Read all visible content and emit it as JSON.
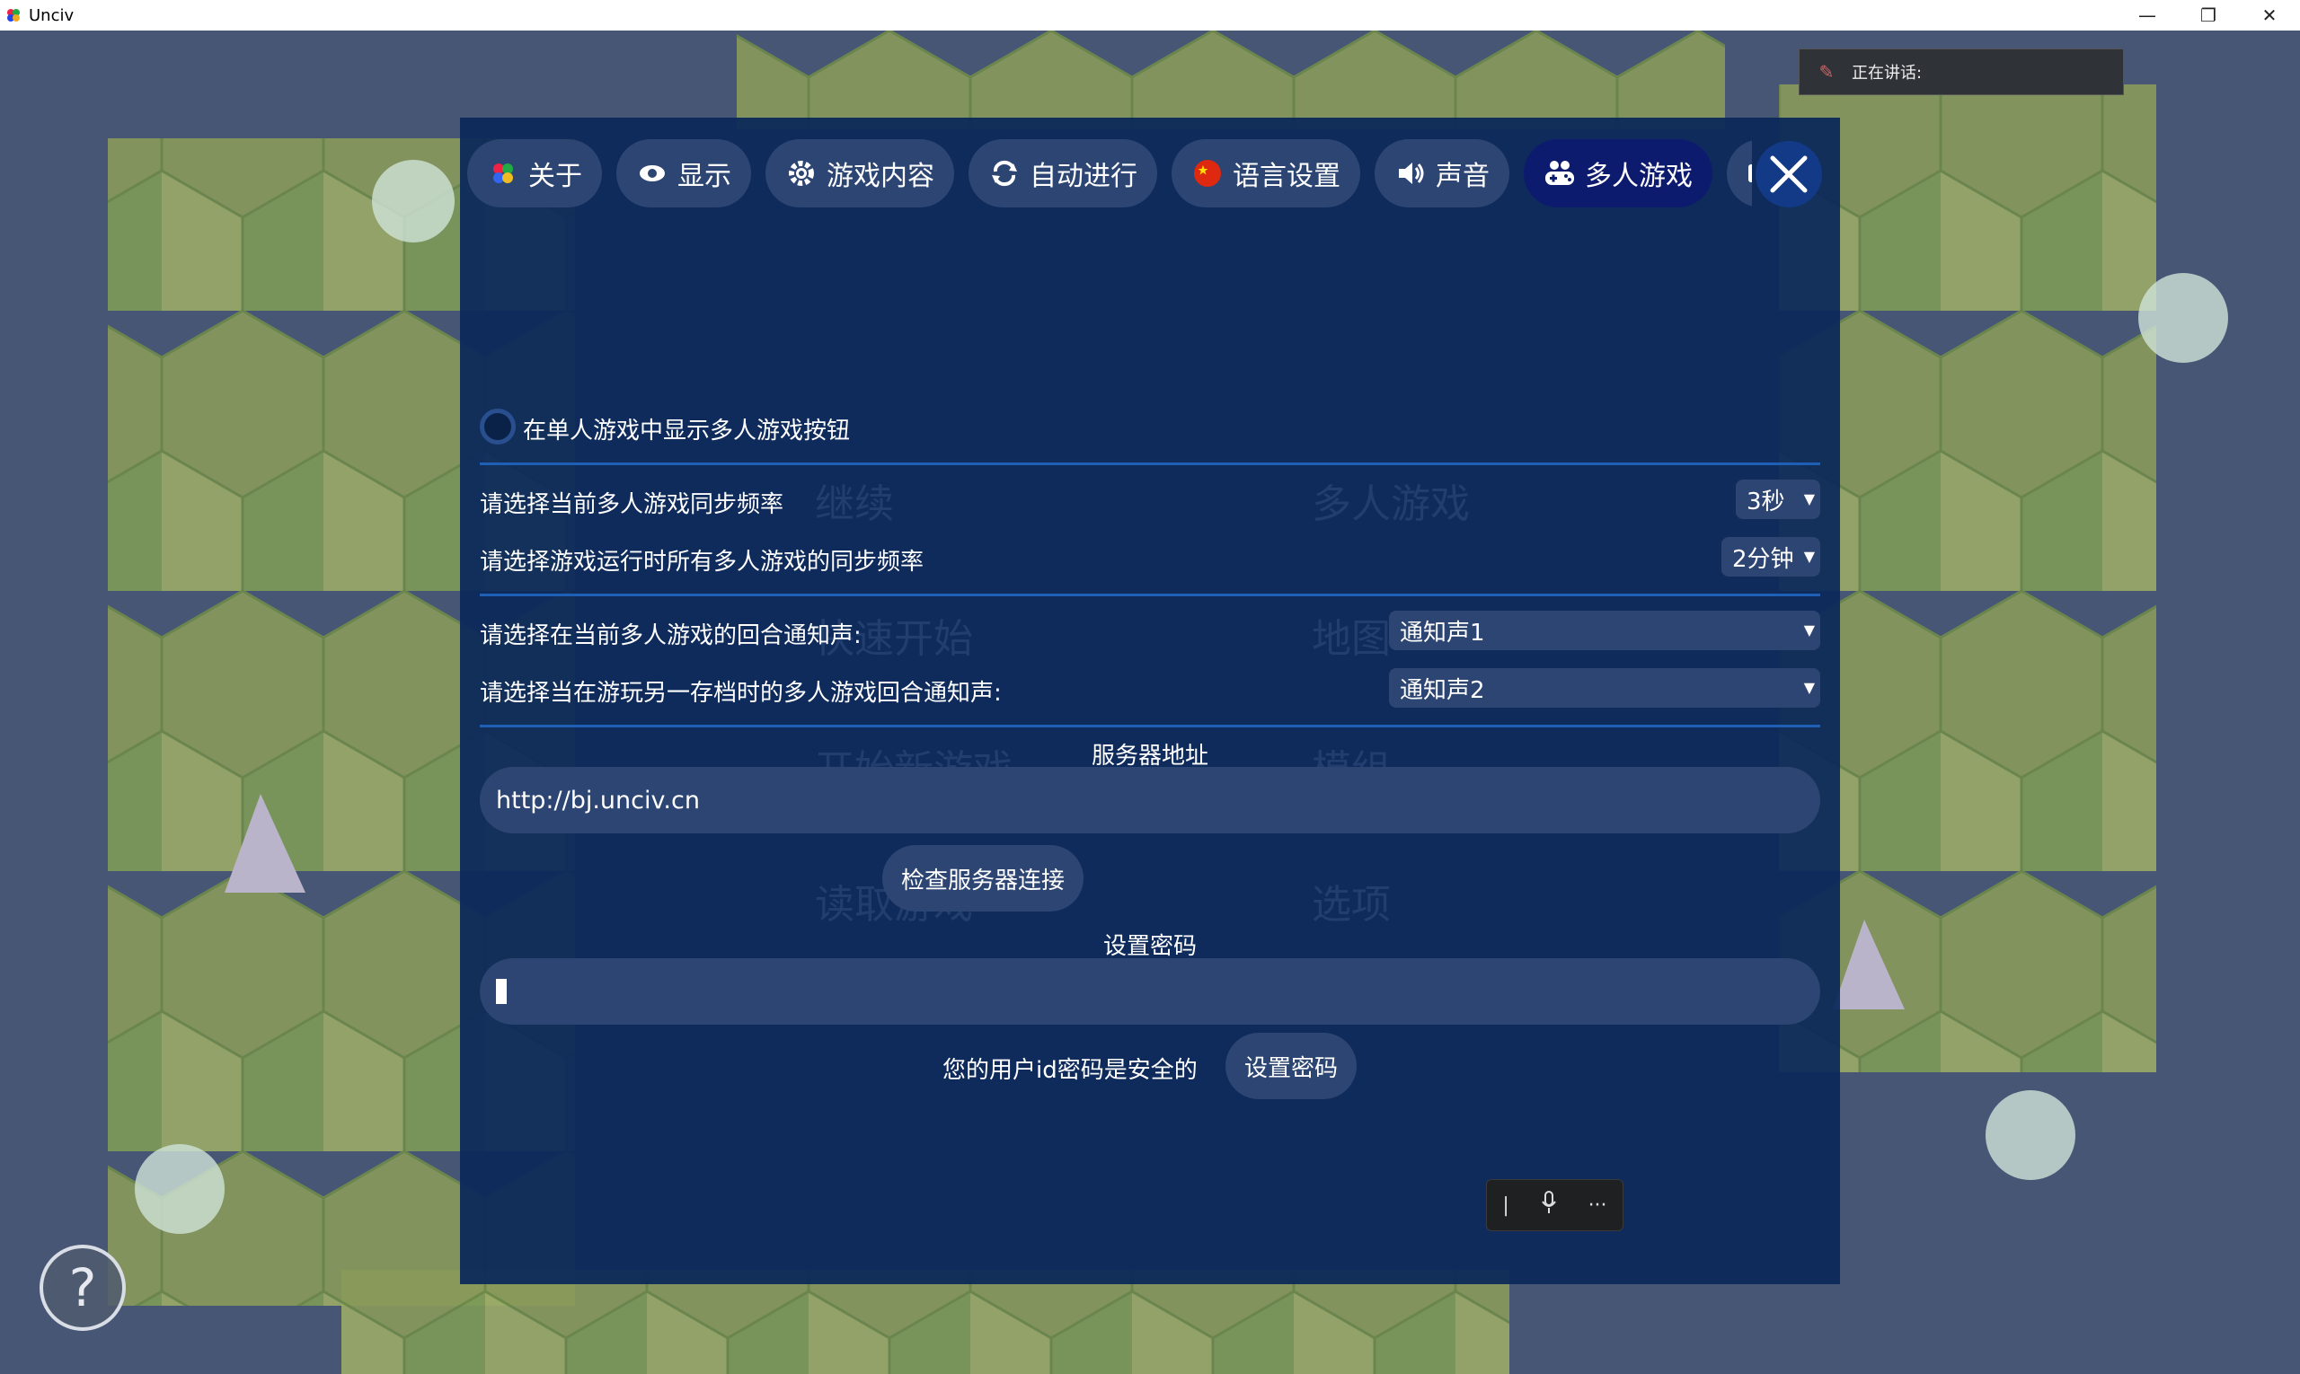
{
  "window": {
    "title": "Unciv",
    "minimize": "—",
    "restore": "❐",
    "close": "✕"
  },
  "speaking": {
    "label": "正在讲话:"
  },
  "tabs": [
    {
      "label": "关于",
      "icon": "about-icon"
    },
    {
      "label": "显示",
      "icon": "eye-icon"
    },
    {
      "label": "游戏内容",
      "icon": "gear-icon"
    },
    {
      "label": "自动进行",
      "icon": "repeat-icon"
    },
    {
      "label": "语言设置",
      "icon": "china-flag-icon"
    },
    {
      "label": "声音",
      "icon": "speaker-icon"
    },
    {
      "label": "多人游戏",
      "icon": "gamepad-icon",
      "active": true
    },
    {
      "label": "",
      "icon": "keyboard-icon"
    }
  ],
  "background_menu": {
    "continue": "继续",
    "multiplayer": "多人游戏",
    "quickstart": "快速开始",
    "map": "地图",
    "newgame": "开始新游戏",
    "mods": "模组",
    "load": "读取游戏",
    "options": "选项"
  },
  "multiplayer": {
    "show_button_label": "在单人游戏中显示多人游戏按钮",
    "current_sync_label": "请选择当前多人游戏同步频率",
    "current_sync_value": "3秒",
    "all_sync_label": "请选择游戏运行时所有多人游戏的同步频率",
    "all_sync_value": "2分钟",
    "current_sound_label": "请选择在当前多人游戏的回合通知声:",
    "current_sound_value": "通知声1",
    "other_sound_label": "请选择当在游玩另一存档时的多人游戏回合通知声:",
    "other_sound_value": "通知声2",
    "server_label": "服务器地址",
    "server_value": "http://bj.unciv.cn",
    "check_button": "检查服务器连接",
    "password_label": "设置密码",
    "password_value": "",
    "secure_text": "您的用户id密码是安全的",
    "set_password_button": "设置密码"
  },
  "ime": {
    "mic": "🎤",
    "more": "···",
    "cursor": "|"
  },
  "help": {
    "label": "?"
  }
}
